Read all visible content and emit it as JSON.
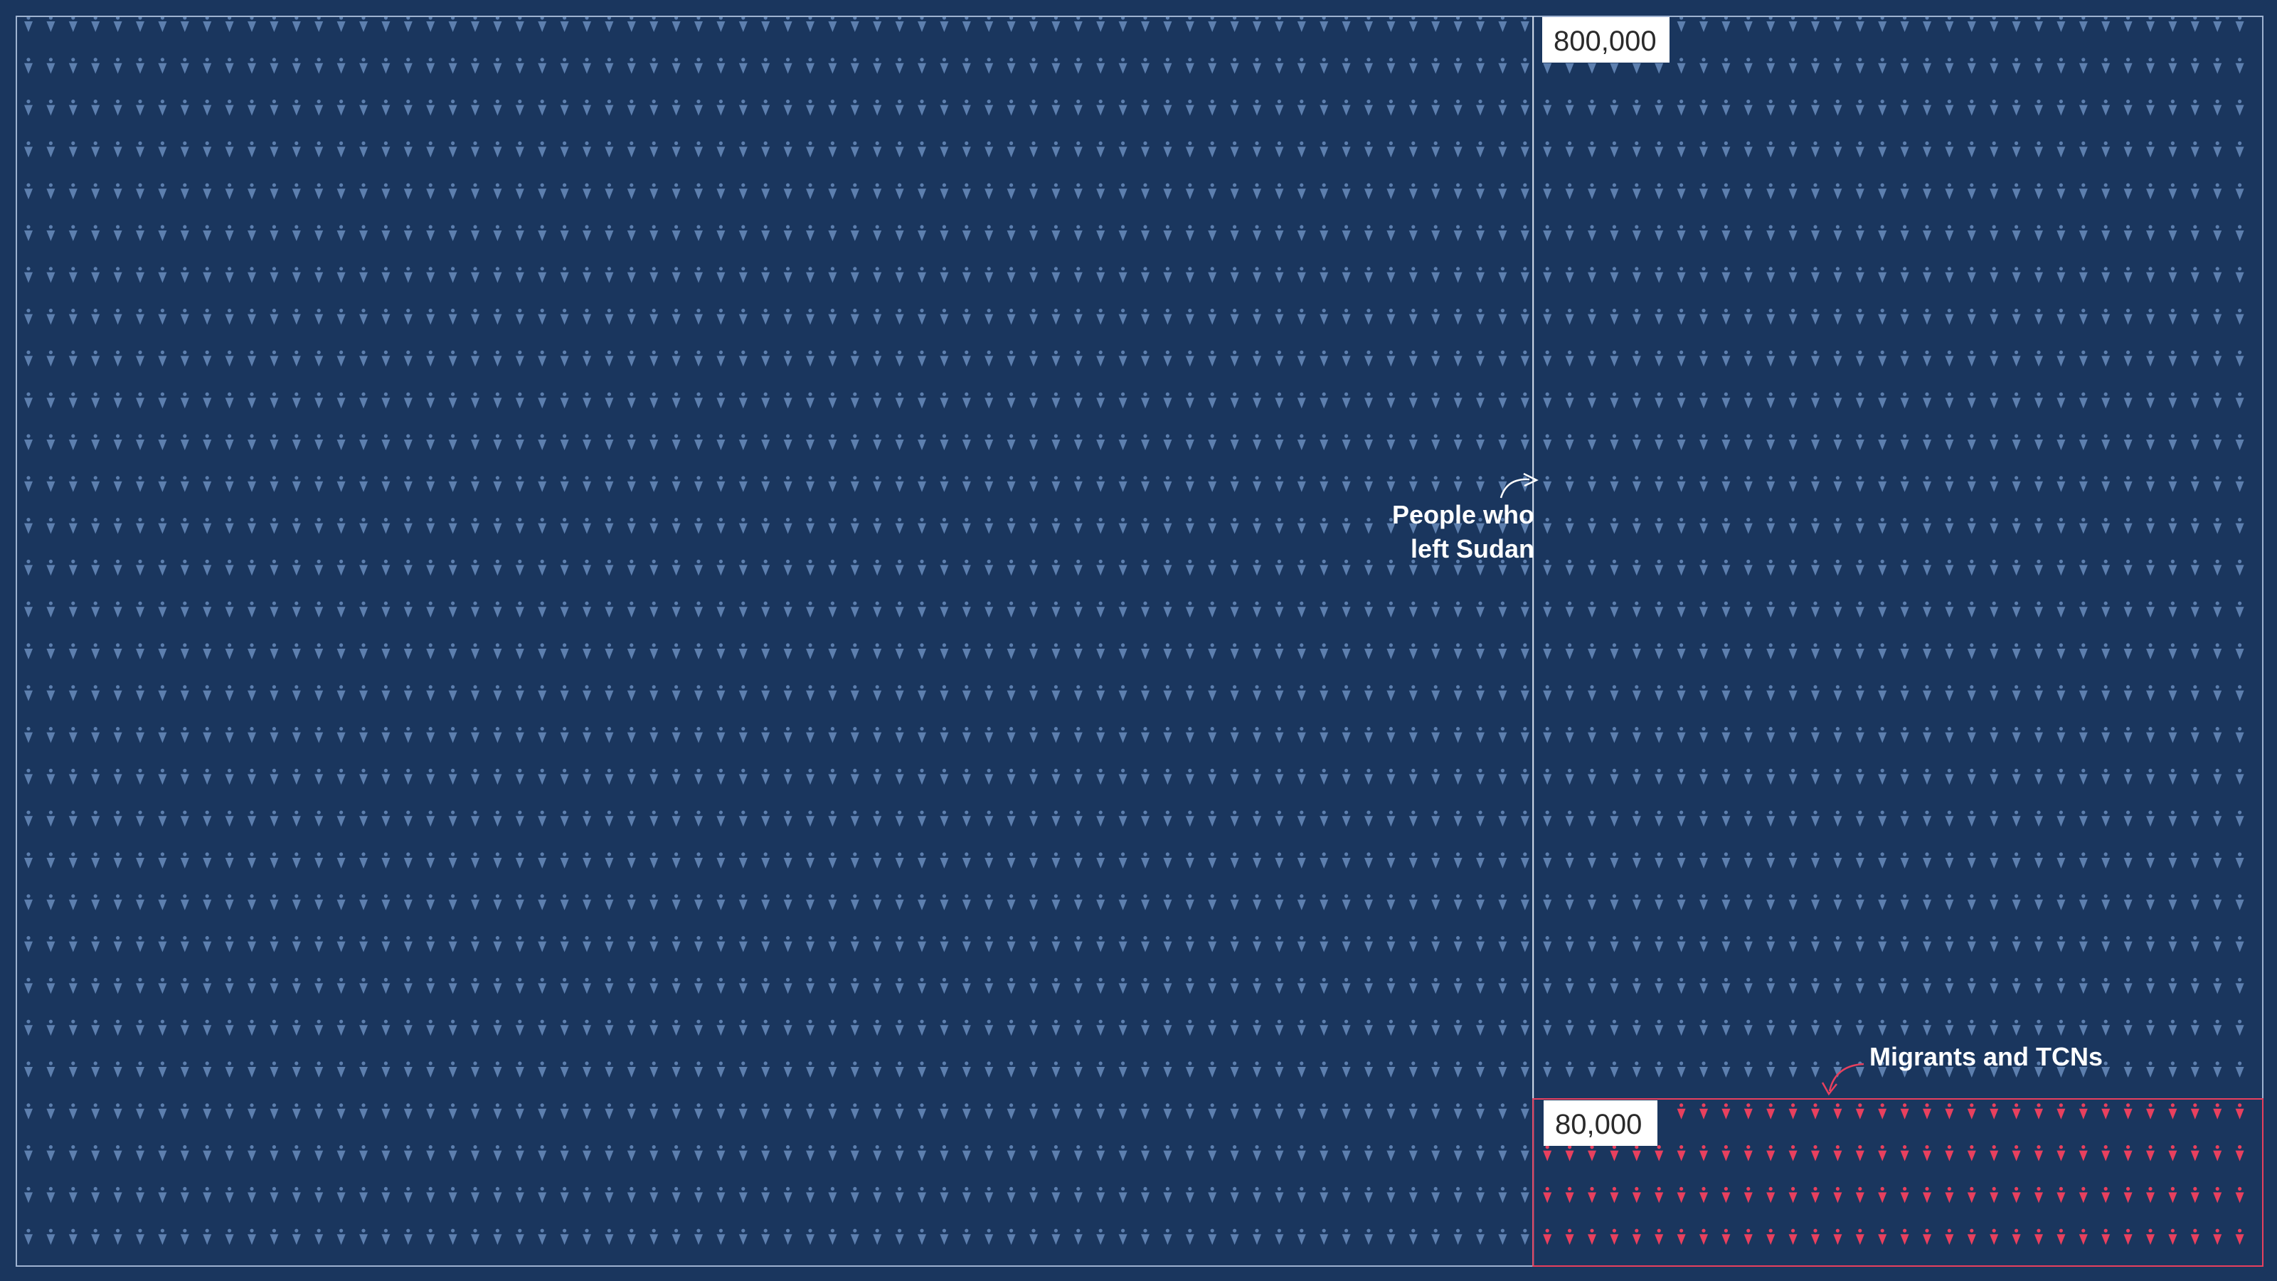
{
  "chart_data": {
    "type": "waffle",
    "unit": "one icon per person",
    "series": [
      {
        "name": "People who left Sudan",
        "value": 800000,
        "color": "#5d7fae"
      },
      {
        "name": "Migrants and TCNs",
        "value": 80000,
        "color": "#e8405e"
      }
    ],
    "labels": {
      "total_box": "800,000",
      "subset_box": "80,000"
    },
    "annotations": {
      "main": [
        "People who",
        "left Sudan"
      ],
      "subset": "Migrants and TCNs"
    },
    "colors": {
      "background": "#1a365e",
      "icon_main": "#5d7fae",
      "icon_subset": "#e8405e",
      "outline_main": "#9fb3d1",
      "outline_subset": "#e8405e"
    }
  }
}
